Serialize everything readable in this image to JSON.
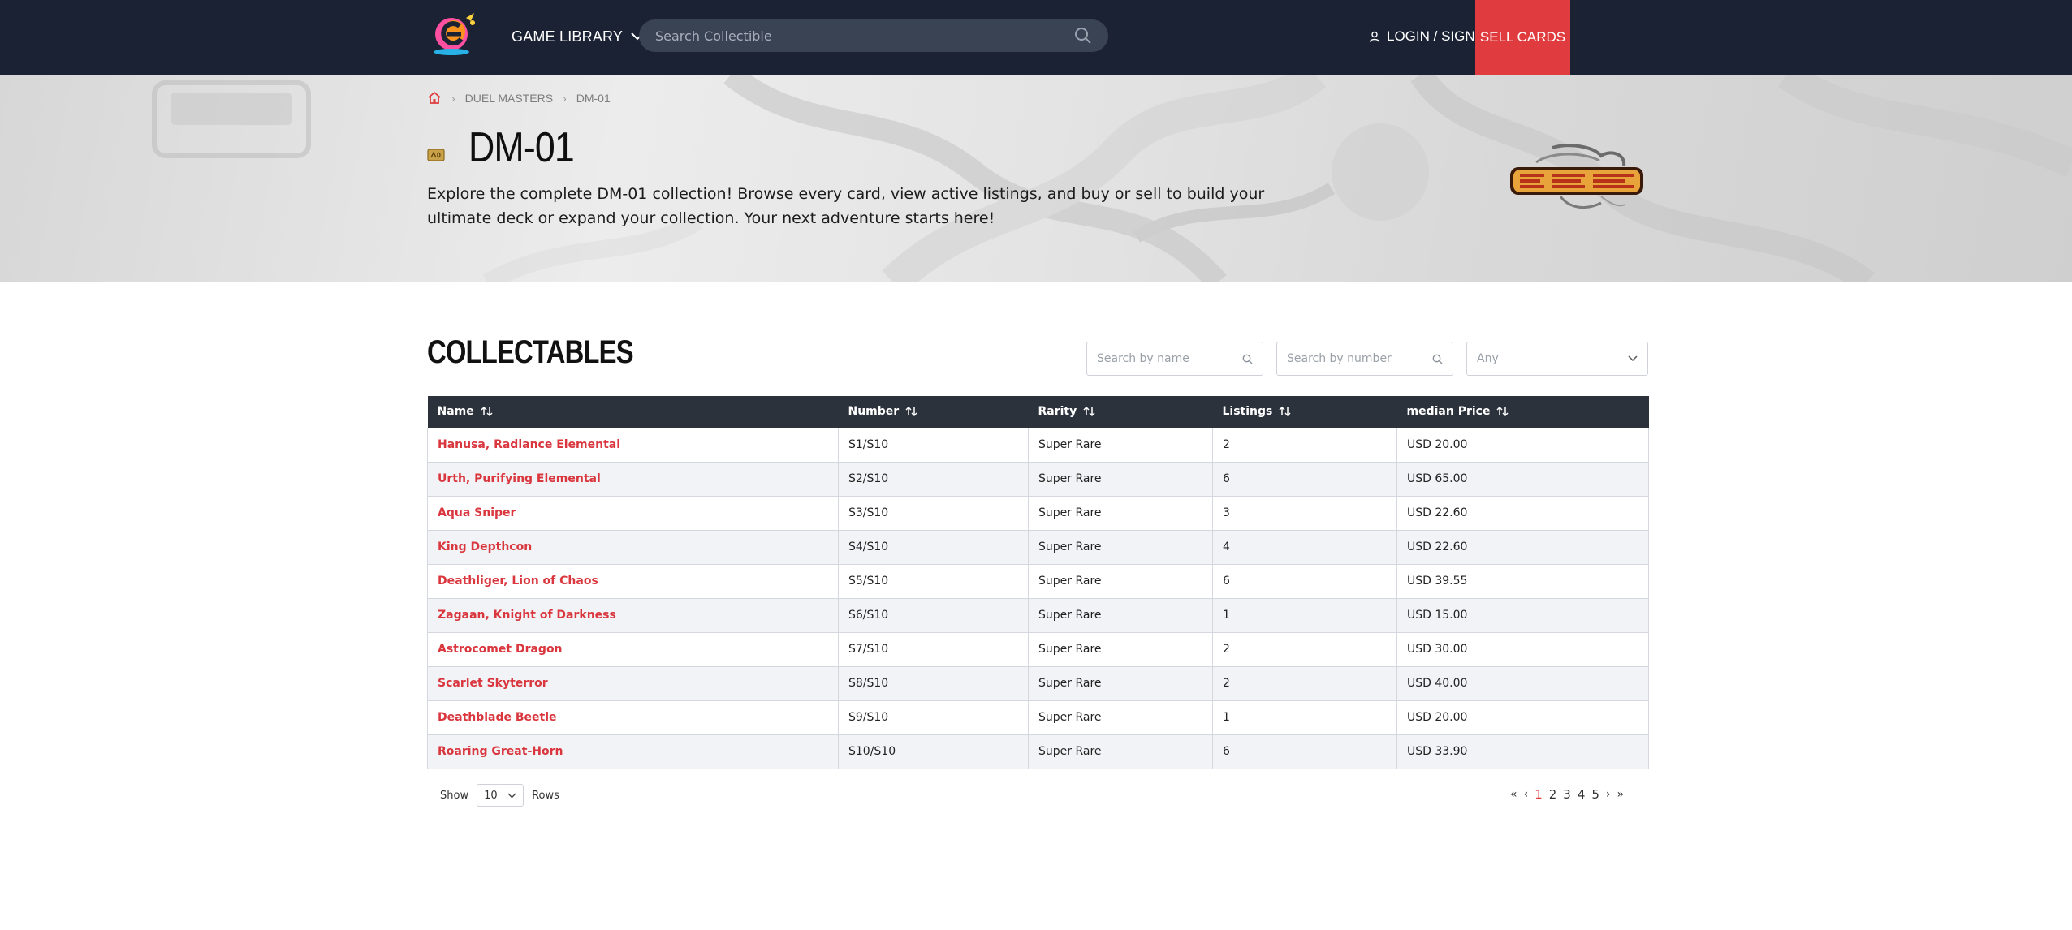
{
  "header": {
    "library_label": "GAME LIBRARY",
    "search_placeholder": "Search Collectible",
    "login_label": "LOGIN / SIGN UP",
    "sell_label": "SELL CARDS"
  },
  "breadcrumb": {
    "game": "DUEL MASTERS",
    "set": "DM-01"
  },
  "hero": {
    "title": "DM-01",
    "description": "Explore the complete DM-01 collection! Browse every card, view active listings, and buy or sell to build your ultimate deck or expand your collection. Your next adventure starts here!"
  },
  "collectables": {
    "title": "COLLECTABLES",
    "name_placeholder": "Search by name",
    "number_placeholder": "Search by number",
    "rarity_value": "Any",
    "columns": [
      "Name",
      "Number",
      "Rarity",
      "Listings",
      "median Price"
    ],
    "rows": [
      {
        "name": "Hanusa, Radiance Elemental",
        "number": "S1/S10",
        "rarity": "Super Rare",
        "listings": "2",
        "price": "USD 20.00"
      },
      {
        "name": "Urth, Purifying Elemental",
        "number": "S2/S10",
        "rarity": "Super Rare",
        "listings": "6",
        "price": "USD 65.00"
      },
      {
        "name": "Aqua Sniper",
        "number": "S3/S10",
        "rarity": "Super Rare",
        "listings": "3",
        "price": "USD 22.60"
      },
      {
        "name": "King Depthcon",
        "number": "S4/S10",
        "rarity": "Super Rare",
        "listings": "4",
        "price": "USD 22.60"
      },
      {
        "name": "Deathliger, Lion of Chaos",
        "number": "S5/S10",
        "rarity": "Super Rare",
        "listings": "6",
        "price": "USD 39.55"
      },
      {
        "name": "Zagaan, Knight of Darkness",
        "number": "S6/S10",
        "rarity": "Super Rare",
        "listings": "1",
        "price": "USD 15.00"
      },
      {
        "name": "Astrocomet Dragon",
        "number": "S7/S10",
        "rarity": "Super Rare",
        "listings": "2",
        "price": "USD 30.00"
      },
      {
        "name": "Scarlet Skyterror",
        "number": "S8/S10",
        "rarity": "Super Rare",
        "listings": "2",
        "price": "USD 40.00"
      },
      {
        "name": "Deathblade Beetle",
        "number": "S9/S10",
        "rarity": "Super Rare",
        "listings": "1",
        "price": "USD 20.00"
      },
      {
        "name": "Roaring Great-Horn",
        "number": "S10/S10",
        "rarity": "Super Rare",
        "listings": "6",
        "price": "USD 33.90"
      }
    ]
  },
  "pagination": {
    "show_label": "Show",
    "rows_value": "10",
    "rows_label": "Rows",
    "first": "«",
    "prev": "‹",
    "next": "›",
    "last": "»",
    "pages": [
      "1",
      "2",
      "3",
      "4",
      "5"
    ],
    "current_page": "1"
  },
  "colors": {
    "header_bg": "#1a2233",
    "accent": "#e03b3e",
    "table_header_bg": "#2c323c"
  }
}
